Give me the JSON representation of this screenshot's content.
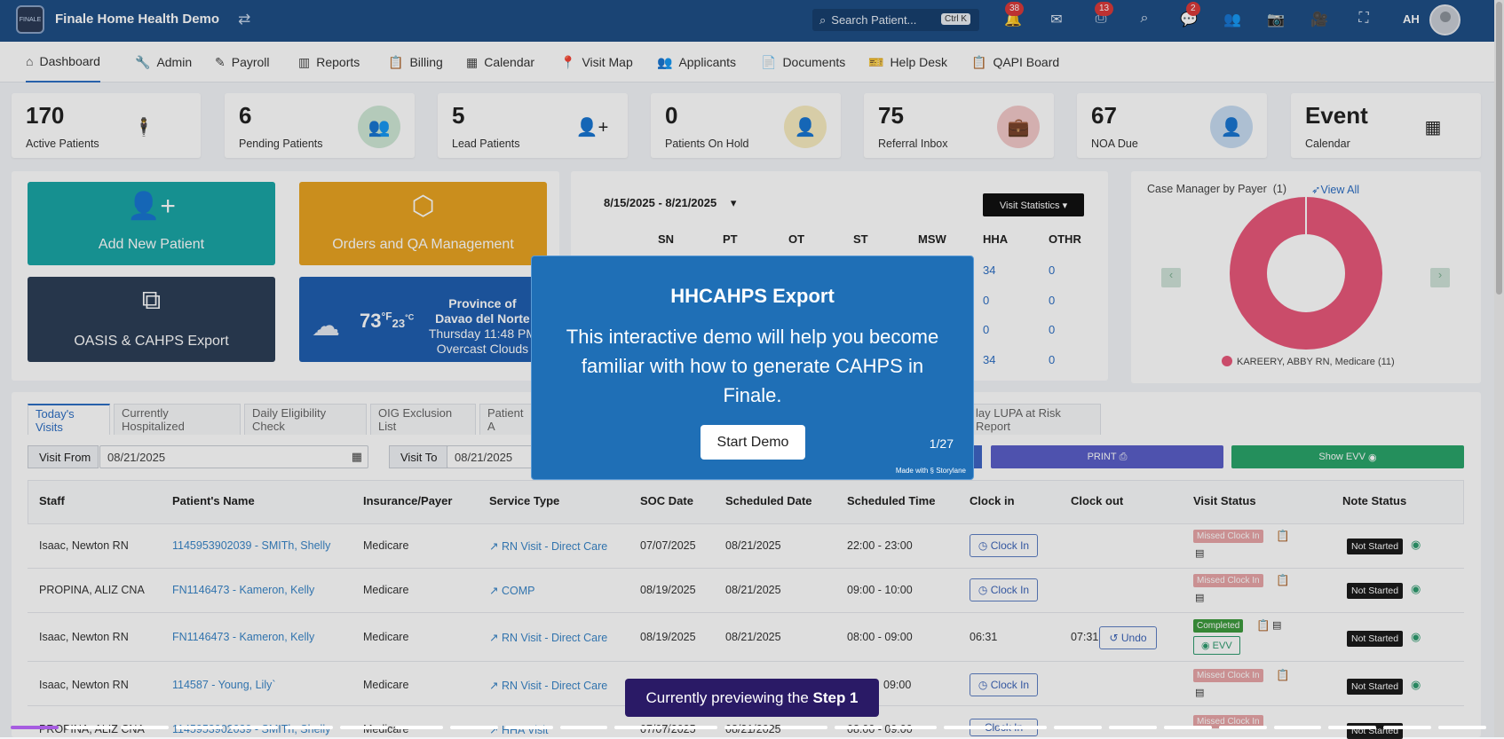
{
  "topbar": {
    "app_title": "Finale Home Health Demo",
    "search_placeholder": "Search Patient...",
    "search_shortcut": "Ctrl K",
    "badges": {
      "notifications": "38",
      "fax": "13",
      "chat": "2"
    },
    "user_initials": "AH",
    "logo_text": "FINALE"
  },
  "nav": [
    {
      "label": "Dashboard",
      "icon": "home-icon"
    },
    {
      "label": "Admin",
      "icon": "wrench-icon"
    },
    {
      "label": "Payroll",
      "icon": "edit-icon"
    },
    {
      "label": "Reports",
      "icon": "chart-icon"
    },
    {
      "label": "Billing",
      "icon": "clipboard-icon"
    },
    {
      "label": "Calendar",
      "icon": "calendar-icon"
    },
    {
      "label": "Visit Map",
      "icon": "map-pin-icon"
    },
    {
      "label": "Applicants",
      "icon": "users-icon"
    },
    {
      "label": "Documents",
      "icon": "document-icon"
    },
    {
      "label": "Help Desk",
      "icon": "ticket-icon"
    },
    {
      "label": "QAPI Board",
      "icon": "board-icon"
    }
  ],
  "stats": [
    {
      "value": "170",
      "label": "Active Patients"
    },
    {
      "value": "6",
      "label": "Pending Patients"
    },
    {
      "value": "5",
      "label": "Lead Patients"
    },
    {
      "value": "0",
      "label": "Patients On Hold"
    },
    {
      "value": "75",
      "label": "Referral Inbox"
    },
    {
      "value": "67",
      "label": "NOA Due"
    },
    {
      "value": "Event",
      "label": "Calendar"
    }
  ],
  "tiles": {
    "add_patient": "Add New Patient",
    "orders": "Orders and QA Management",
    "oasis": "OASIS & CAHPS Export"
  },
  "weather": {
    "temp_f": "73",
    "unit_f": "°F",
    "temp_c": "23",
    "unit_c": "°C",
    "location_1": "Province of",
    "location_2": "Davao del Norte",
    "time": "Thursday 11:48 PM",
    "condition": "Overcast Clouds"
  },
  "visit_stats": {
    "date_range": "8/15/2025 - 8/21/2025",
    "button": "Visit Statistics ▾",
    "headers": [
      "SN",
      "PT",
      "OT",
      "ST",
      "MSW",
      "HHA",
      "OTHR"
    ],
    "hha": [
      "34",
      "0",
      "0",
      "34"
    ],
    "othr": [
      "0",
      "0",
      "0",
      "0"
    ]
  },
  "case_manager": {
    "title": "Case Manager by Payer",
    "count": "(1)",
    "view_all": "View All",
    "legend": "KAREERY, ABBY RN, Medicare (11)"
  },
  "tabs": [
    "Today's Visits",
    "Currently Hospitalized",
    "Daily Eligibility Check",
    "OIG Exclusion List",
    "Patient A",
    "lay LUPA at Risk Report"
  ],
  "filters": {
    "visit_from_label": "Visit From",
    "visit_from": "08/21/2025",
    "visit_to_label": "Visit To",
    "visit_to": "08/21/2025",
    "print": "PRINT",
    "show_evv": "Show EVV"
  },
  "table": {
    "headers": [
      "Staff",
      "Patient's Name",
      "Insurance/Payer",
      "Service Type",
      "SOC Date",
      "Scheduled Date",
      "Scheduled Time",
      "Clock in",
      "Clock out",
      "Visit Status",
      "Note Status"
    ],
    "rows": [
      {
        "staff": "Isaac, Newton RN",
        "patient": "1145953902039 - SMITh, Shelly",
        "payer": "Medicare",
        "service": "RN Visit - Direct Care",
        "soc": "07/07/2025",
        "sched": "08/21/2025",
        "time": "22:00 - 23:00",
        "clock_in": "Clock In",
        "clock_out": "",
        "status": "Missed Clock In",
        "note": "Not Started"
      },
      {
        "staff": "PROPINA, ALIZ CNA",
        "patient": "FN1146473 - Kameron, Kelly",
        "payer": "Medicare",
        "service": "COMP",
        "soc": "08/19/2025",
        "sched": "08/21/2025",
        "time": "09:00 - 10:00",
        "clock_in": "Clock In",
        "clock_out": "",
        "status": "Missed Clock In",
        "note": "Not Started"
      },
      {
        "staff": "Isaac, Newton RN",
        "patient": "FN1146473 - Kameron, Kelly",
        "payer": "Medicare",
        "service": "RN Visit - Direct Care",
        "soc": "08/19/2025",
        "sched": "08/21/2025",
        "time": "08:00 - 09:00",
        "clock_in": "06:31",
        "clock_out": "07:31",
        "undo": "Undo",
        "status": "Completed",
        "evv": "EVV",
        "note": "Not Started"
      },
      {
        "staff": "Isaac, Newton RN",
        "patient": "114587 - Young, Lily`",
        "payer": "Medicare",
        "service": "RN Visit - Direct Care",
        "soc": "",
        "sched": "",
        "time": "09:00",
        "clock_in": "Clock In",
        "clock_out": "",
        "status": "Missed Clock In",
        "note": "Not Started"
      },
      {
        "staff": "PROPINA, ALIZ CNA",
        "patient": "1145953902039 - SMITh, Shelly",
        "payer": "Medicare",
        "service": "HHA Visit",
        "soc": "07/07/2025",
        "sched": "08/21/2025",
        "time": "08:00 - 09:00",
        "clock_in": "Clock In",
        "clock_out": "",
        "status": "Missed Clock In",
        "note": "Not Started"
      }
    ]
  },
  "modal": {
    "title": "HHCAHPS Export",
    "body": "This interactive demo will help you become familiar with how to generate CAHPS in Finale.",
    "button": "Start Demo",
    "step": "1/27",
    "made_with": "Made with § Storylane"
  },
  "preview": {
    "text": "Currently previewing the ",
    "step": "Step 1"
  }
}
